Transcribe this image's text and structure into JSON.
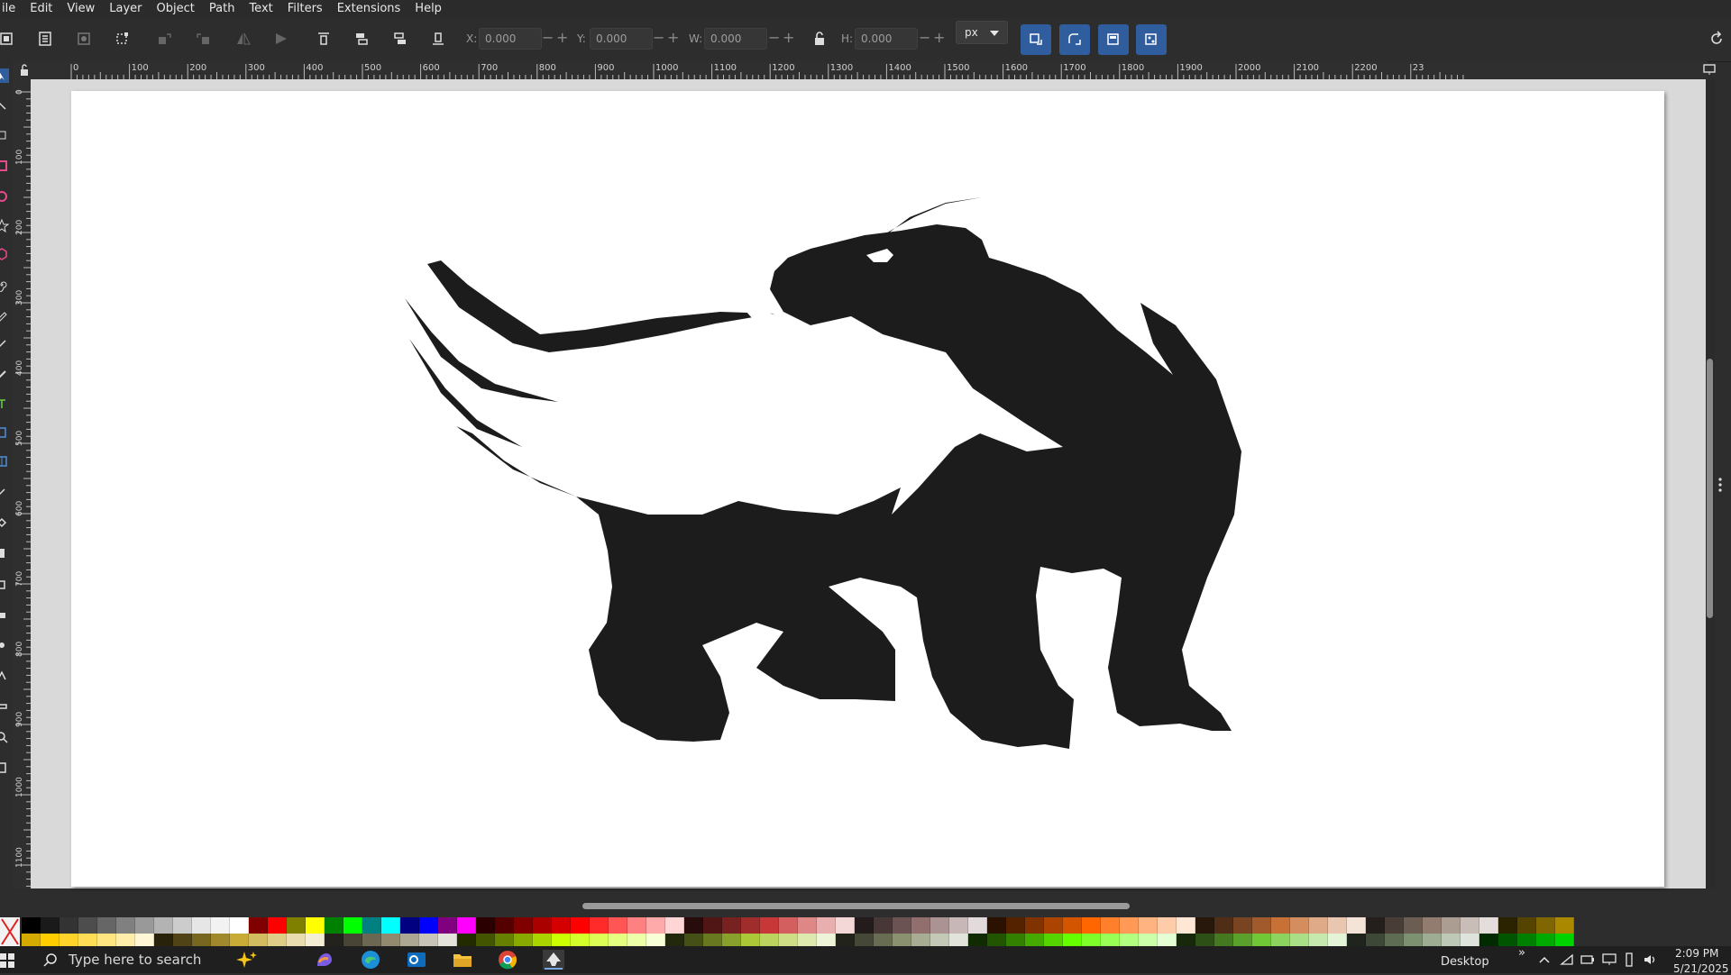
{
  "menu": {
    "items": [
      "ile",
      "Edit",
      "View",
      "Layer",
      "Object",
      "Path",
      "Text",
      "Filters",
      "Extensions",
      "Help"
    ]
  },
  "toolbar": {
    "x_label": "X:",
    "x_value": "0.000",
    "y_label": "Y:",
    "y_value": "0.000",
    "w_label": "W:",
    "w_value": "0.000",
    "h_label": "H:",
    "h_value": "0.000",
    "unit": "px"
  },
  "ruler": {
    "h_labels": [
      "0",
      "100",
      "200",
      "300",
      "400",
      "500",
      "600",
      "700",
      "800",
      "900",
      "1000",
      "1100",
      "1200",
      "1300",
      "1400",
      "1500",
      "1600",
      "1700",
      "1800",
      "1900",
      "2000",
      "2100",
      "2200",
      "23"
    ],
    "v_labels": [
      "0",
      "100",
      "200",
      "300",
      "400",
      "500",
      "600",
      "700",
      "800",
      "900",
      "1000",
      "1100"
    ]
  },
  "palette": {
    "top": [
      "#000000",
      "#1a1a1a",
      "#333333",
      "#4d4d4d",
      "#666666",
      "#808080",
      "#999999",
      "#b3b3b3",
      "#cccccc",
      "#e6e6e6",
      "#f2f2f2",
      "#ffffff",
      "#800000",
      "#ff0000",
      "#808000",
      "#ffff00",
      "#008000",
      "#00ff00",
      "#008080",
      "#00ffff",
      "#000080",
      "#0000ff",
      "#800080",
      "#ff00ff",
      "#2b0000",
      "#550000",
      "#800000",
      "#aa0000",
      "#d40000",
      "#ff0000",
      "#ff2a2a",
      "#ff5555",
      "#ff8080",
      "#ffaaaa",
      "#ffd5d5",
      "#280b0b",
      "#501616",
      "#782121",
      "#a02c2c",
      "#c83737",
      "#d35f5f",
      "#de8787",
      "#e9afaf",
      "#f4d7d7",
      "#241c1c",
      "#483737",
      "#6c5353",
      "#916f6f",
      "#ac9393",
      "#c8b7b7",
      "#e3dbdb",
      "#2b1100",
      "#552200",
      "#803300",
      "#aa4400",
      "#d45500",
      "#ff6600",
      "#ff7f2a",
      "#ff9955",
      "#ffb380",
      "#ffccaa",
      "#ffe6d5",
      "#28170b",
      "#502d16",
      "#784421",
      "#a05a2c",
      "#c87137",
      "#d38d5f",
      "#deaa87",
      "#e9c6af",
      "#f4e3d7",
      "#241f1c",
      "#483e37",
      "#6c5d53",
      "#917c6f",
      "#ac9d93",
      "#c8beb7",
      "#e3dedb",
      "#2b2200",
      "#554400",
      "#806600",
      "#aa8800"
    ],
    "bottom": [
      "#d4aa00",
      "#ffcc00",
      "#ffd42a",
      "#ffdd55",
      "#ffe680",
      "#ffeeaa",
      "#fff6d5",
      "#28220b",
      "#504416",
      "#786721",
      "#a0892c",
      "#c8ab37",
      "#d3bc5f",
      "#decd87",
      "#e9ddaf",
      "#f4eed7",
      "#24221c",
      "#484537",
      "#6c6753",
      "#918a6f",
      "#aca793",
      "#c8c4b7",
      "#e3e2db",
      "#222b00",
      "#445500",
      "#668000",
      "#88aa00",
      "#aad400",
      "#ccff00",
      "#d4ff2a",
      "#ddff55",
      "#e5ff80",
      "#eeffaa",
      "#f6ffd5",
      "#22280b",
      "#445016",
      "#677821",
      "#89a02c",
      "#abc837",
      "#bcd35f",
      "#cdde87",
      "#dde9af",
      "#eef4d7",
      "#22241c",
      "#454837",
      "#676c53",
      "#8a916f",
      "#a7ac93",
      "#c4c8b7",
      "#e2e3db",
      "#112b00",
      "#225500",
      "#338000",
      "#44aa00",
      "#55d400",
      "#66ff00",
      "#7fff2a",
      "#99ff55",
      "#b3ff80",
      "#ccffaa",
      "#e5ffd5",
      "#17280b",
      "#2d5016",
      "#447821",
      "#5aa02c",
      "#71c837",
      "#8dd35f",
      "#aade87",
      "#c6e9af",
      "#e3f4d7",
      "#1f241c",
      "#3e4837",
      "#5d6c53",
      "#7c916f",
      "#9dac93",
      "#bec8b7",
      "#dee3db",
      "#002b00",
      "#005500",
      "#008000",
      "#00aa00",
      "#00d400"
    ]
  },
  "taskbar": {
    "search_placeholder": "Type here to search",
    "desktop_label": "Desktop",
    "time": "2:09 PM",
    "date": "5/21/2025"
  },
  "colors": {
    "artwork_fill": "#1c1c1c",
    "accent_button": "#2f5d9e"
  }
}
